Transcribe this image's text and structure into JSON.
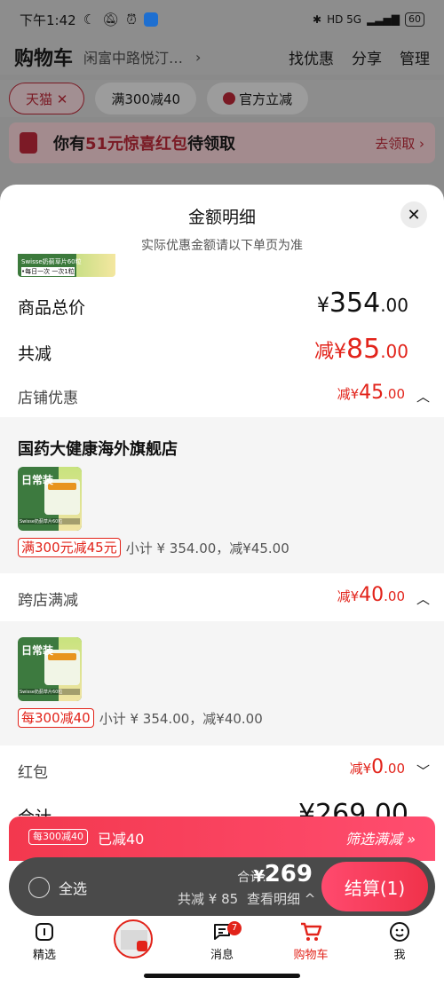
{
  "status_bar": {
    "time": "下午1:42",
    "left_icons": [
      "moon-icon",
      "mute-bell-icon",
      "alarm-icon",
      "app-notify-icon"
    ],
    "right_text": "HD 5G",
    "battery": "60"
  },
  "header": {
    "title": "购物车",
    "address": "闲富中路悦汀…",
    "actions": [
      "找优惠",
      "分享",
      "管理"
    ]
  },
  "filters": [
    {
      "label": "天猫 ✕",
      "active": true
    },
    {
      "label": "满300减40",
      "active": false
    },
    {
      "label": "官方立减",
      "active": false
    }
  ],
  "banner": {
    "prefix": "你有",
    "highlight": "51元惊喜红包",
    "suffix": "待领取",
    "action": "去领取 ›"
  },
  "sheet": {
    "title": "金额明细",
    "subtitle": "实际优惠金额请以下单页为准",
    "peek_text_1": "Swisse奶蓟草片60粒",
    "peek_text_2": "•每日一次 一次1粒",
    "total_label": "商品总价",
    "total_yen": "¥",
    "total_int": "354",
    "total_dec": ".00",
    "reduce_label": "共减",
    "reduce_prefix": "减¥",
    "reduce_int": "85",
    "reduce_dec": ".00",
    "store_discount": {
      "label": "店铺优惠",
      "prefix": "减¥",
      "int": "45",
      "dec": ".00"
    },
    "store": {
      "name": "国药大健康海外旗舰店",
      "img_text": "日常装",
      "img_sub": "Swisse奶蓟草片60粒",
      "tag": "满300元减45元",
      "subtotal": "小计 ¥ 354.00，减¥45.00"
    },
    "cross_store": {
      "label": "跨店满减",
      "prefix": "减¥",
      "int": "40",
      "dec": ".00",
      "img_text": "日常装",
      "img_sub": "Swisse奶蓟草片60粒",
      "tag": "每300减40",
      "subtotal": "小计 ¥ 354.00，减¥40.00"
    },
    "red_packet": {
      "label": "红包",
      "prefix": "减¥",
      "int": "0",
      "dec": ".00"
    },
    "sum_label": "合计",
    "sum_price": "¥269.00"
  },
  "promo_bar": {
    "tag": "每300减40",
    "text": "已减40",
    "link": "筛选满减 »"
  },
  "checkout": {
    "select_all": "全选",
    "total_label": "合计:",
    "total_yen": "¥",
    "total_amount": "269",
    "discount": "共减 ¥ 85",
    "detail": "查看明细 ^",
    "pay": "结算(1)"
  },
  "tabs": [
    {
      "label": "精选",
      "icon": "home-icon"
    },
    {
      "label": "",
      "icon": "live-icon"
    },
    {
      "label": "消息",
      "icon": "message-icon",
      "badge": "7"
    },
    {
      "label": "购物车",
      "icon": "cart-icon",
      "active": true
    },
    {
      "label": "我",
      "icon": "profile-icon"
    }
  ],
  "colors": {
    "accent": "#e2231a",
    "pay_button": "#f0324a",
    "promo_bar": "#f3384e"
  }
}
